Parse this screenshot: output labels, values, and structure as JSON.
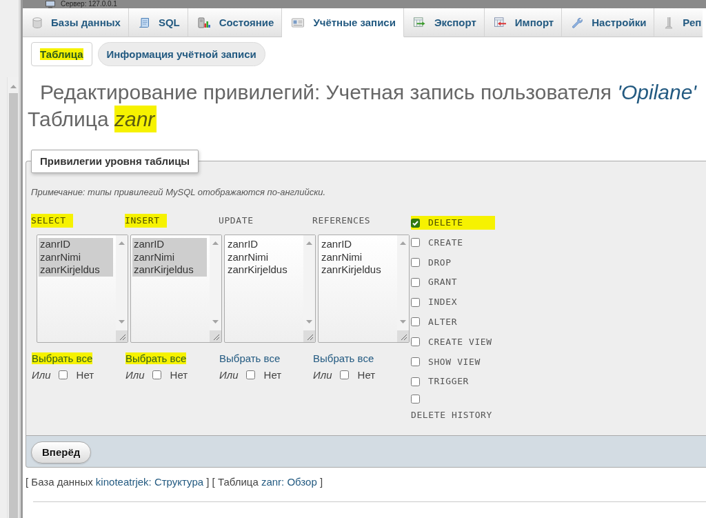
{
  "top_bar": {
    "server": "Сервер: 127.0.0.1"
  },
  "tabs": [
    {
      "kind": "databases",
      "label": "Базы данных",
      "selected": false
    },
    {
      "kind": "sql",
      "label": "SQL",
      "selected": false
    },
    {
      "kind": "status",
      "label": "Состояние",
      "selected": false
    },
    {
      "kind": "accounts",
      "label": "Учётные записи",
      "selected": true
    },
    {
      "kind": "export",
      "label": "Экспорт",
      "selected": false
    },
    {
      "kind": "import",
      "label": "Импорт",
      "selected": false
    },
    {
      "kind": "settings",
      "label": "Настройки",
      "selected": false
    },
    {
      "kind": "replication",
      "label": "Реп",
      "selected": false
    }
  ],
  "subtabs": [
    {
      "label": "Таблица",
      "selected": true,
      "highlighted": true
    },
    {
      "label": "Информация учётной записи",
      "selected": false,
      "highlighted": false
    }
  ],
  "title": {
    "text": "Редактирование привилегий: Учетная запись пользователя",
    "user": "'Opilane'",
    "table_label": "Таблица",
    "table": "zanr",
    "table_highlighted": true
  },
  "privileges_panel": {
    "legend": "Привилегии уровня таблицы",
    "note": "Примечание: типы привилегий MySQL отображаются по-английски.",
    "columns": [
      {
        "name": "SELECT",
        "highlighted": true,
        "options": [
          {
            "label": "zanrID",
            "selected": true
          },
          {
            "label": "zanrNimi",
            "selected": true
          },
          {
            "label": "zanrKirjeldus",
            "selected": true
          }
        ],
        "select_all": "Выбрать все",
        "select_all_highlighted": true,
        "or_label": "Или",
        "none_label": "Нет",
        "none_checked": false
      },
      {
        "name": "INSERT",
        "highlighted": true,
        "options": [
          {
            "label": "zanrID",
            "selected": true
          },
          {
            "label": "zanrNimi",
            "selected": true
          },
          {
            "label": "zanrKirjeldus",
            "selected": true
          }
        ],
        "select_all": "Выбрать все",
        "select_all_highlighted": true,
        "or_label": "Или",
        "none_label": "Нет",
        "none_checked": false
      },
      {
        "name": "UPDATE",
        "highlighted": false,
        "options": [
          {
            "label": "zanrID",
            "selected": false
          },
          {
            "label": "zanrNimi",
            "selected": false
          },
          {
            "label": "zanrKirjeldus",
            "selected": false
          }
        ],
        "select_all": "Выбрать все",
        "select_all_highlighted": false,
        "or_label": "Или",
        "none_label": "Нет",
        "none_checked": false
      },
      {
        "name": "REFERENCES",
        "highlighted": false,
        "options": [
          {
            "label": "zanrID",
            "selected": false
          },
          {
            "label": "zanrNimi",
            "selected": false
          },
          {
            "label": "zanrKirjeldus",
            "selected": false
          }
        ],
        "select_all": "Выбрать все",
        "select_all_highlighted": false,
        "or_label": "Или",
        "none_label": "Нет",
        "none_checked": false
      }
    ],
    "privileges": [
      {
        "label": "DELETE",
        "checked": true,
        "highlighted": true
      },
      {
        "label": "CREATE",
        "checked": false,
        "highlighted": false
      },
      {
        "label": "DROP",
        "checked": false,
        "highlighted": false
      },
      {
        "label": "GRANT",
        "checked": false,
        "highlighted": false
      },
      {
        "label": "INDEX",
        "checked": false,
        "highlighted": false
      },
      {
        "label": "ALTER",
        "checked": false,
        "highlighted": false
      },
      {
        "label": "CREATE VIEW",
        "checked": false,
        "highlighted": false
      },
      {
        "label": "SHOW VIEW",
        "checked": false,
        "highlighted": false
      },
      {
        "label": "TRIGGER",
        "checked": false,
        "highlighted": false
      },
      {
        "label": "DELETE HISTORY",
        "checked": false,
        "highlighted": false
      }
    ],
    "submit": "Вперёд"
  },
  "footer_links": [
    {
      "prefix": "[ База данных",
      "link": "kinoteatrjek: Структура",
      "suffix": "]"
    },
    {
      "prefix": "[ Таблица",
      "link": "zanr: Обзор",
      "suffix": "]"
    }
  ]
}
